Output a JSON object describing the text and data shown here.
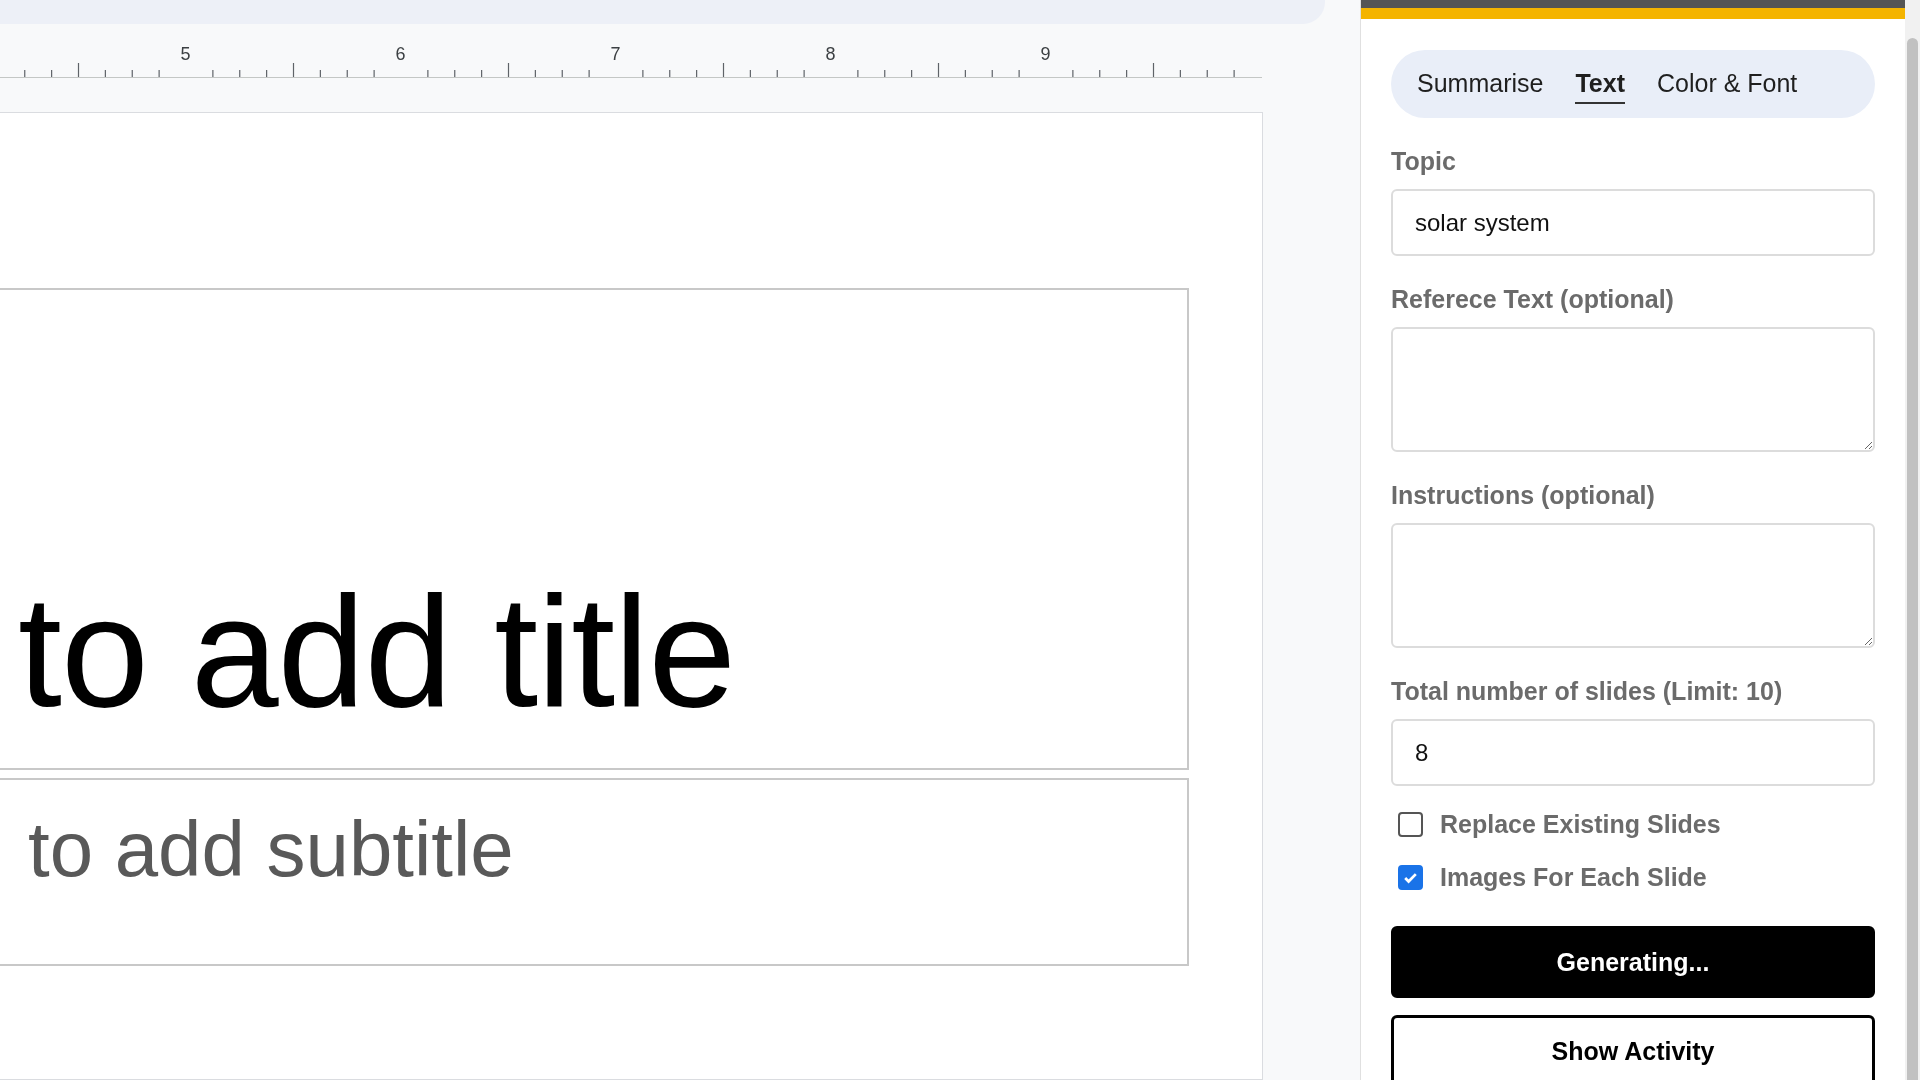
{
  "ruler": {
    "numbers": [
      "5",
      "6",
      "7",
      "8",
      "9"
    ]
  },
  "slide": {
    "title_placeholder": "to add title",
    "subtitle_placeholder": "to add subtitle"
  },
  "panel": {
    "tabs": [
      {
        "label": "Summarise",
        "selected": false
      },
      {
        "label": "Text",
        "selected": true
      },
      {
        "label": "Color & Font",
        "selected": false
      }
    ],
    "fields": [
      {
        "kind": "input",
        "label": "Topic",
        "value": "solar system"
      },
      {
        "kind": "textarea",
        "label": "Referece Text (optional)"
      },
      {
        "kind": "textarea",
        "label": "Instructions (optional)"
      },
      {
        "kind": "input",
        "label": "Total number of slides (Limit: 10)",
        "value": "8"
      }
    ],
    "options": [
      {
        "label": "Replace Existing Slides",
        "checked": false
      },
      {
        "label": "Images For Each Slide",
        "checked": true
      }
    ],
    "buttons": [
      {
        "kind": "primary",
        "label": "Generating..."
      },
      {
        "kind": "secondary",
        "label": "Show Activity"
      }
    ]
  }
}
